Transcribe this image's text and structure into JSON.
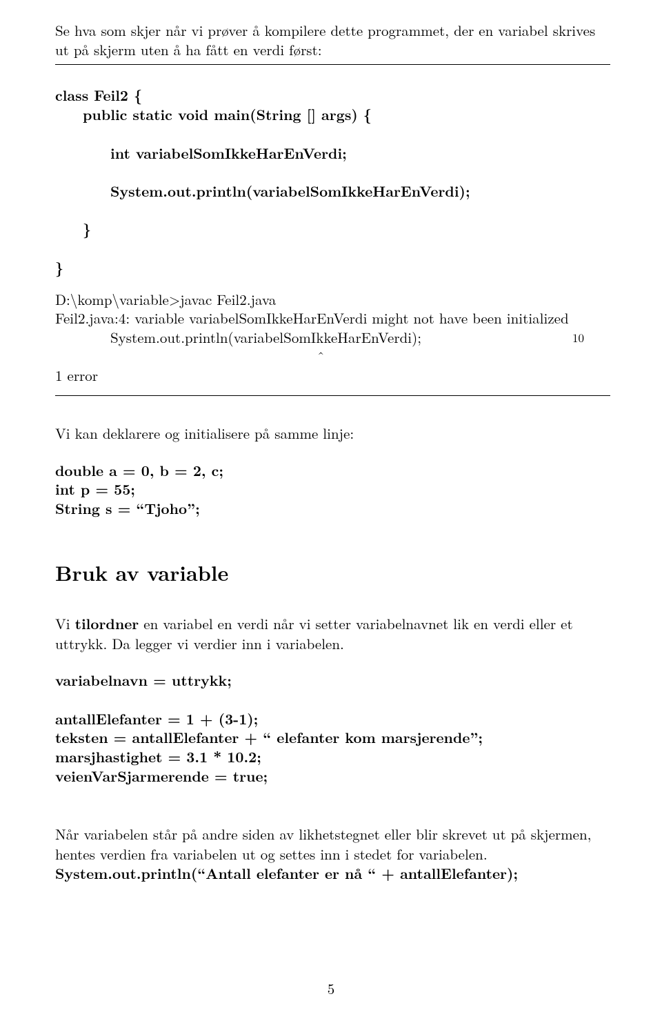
{
  "intro1": "Se hva som skjer når vi prøver å kompilere dette programmet, der en variabel skrives ut på skjerm uten å ha fått en verdi først:",
  "code": {
    "l1": "class Feil2 {",
    "l2": "public static void main(String [] args) {",
    "l3": "int variabelSomIkkeHarEnVerdi;",
    "l4": "System.out.println(variabelSomIkkeHarEnVerdi);",
    "l5": "}",
    "l6": "}"
  },
  "compile": {
    "l1": "D:\\komp\\variable>javac Feil2.java",
    "l2": "Feil2.java:4: variable variabelSomIkkeHarEnVerdi might not have been initialized",
    "l3": "System.out.println(variabelSomIkkeHarEnVerdi);",
    "l4": "ˆ",
    "l5": "1 error"
  },
  "marginNum": "10",
  "declInit": "Vi kan deklarere og initialisere på samme linje:",
  "declBlock": {
    "l1": "double a = 0, b = 2, c;",
    "l2": "int p = 55;",
    "l3": "String s = “Tjoho”;"
  },
  "secTitle": "Bruk av variable",
  "assignPara_a": "Vi ",
  "assignPara_b": "tilordner",
  "assignPara_c": " en variabel en verdi når vi setter variabelnavnet lik en verdi eller et uttrykk. Da legger vi verdier inn i variabelen.",
  "assignSyntax": "variabelnavn = uttrykk;",
  "exBlock": {
    "l1": "antallElefanter = 1 + (3-1);",
    "l2": "teksten = antallElefanter + “ elefanter kom marsjerende”;",
    "l3": "marsjhastighet = 3.1 * 10.2;",
    "l4": "veienVarSjarmerende = true;"
  },
  "finalPara_a": "Når variabelen står på andre siden av likhetstegnet eller blir skrevet ut på skjermen, hentes verdien fra variabelen ut og settes inn i stedet for variabelen. ",
  "finalPara_b": "System.out.println(“Antall elefanter er nå “ + antallElefanter);",
  "pageNumber": "5"
}
